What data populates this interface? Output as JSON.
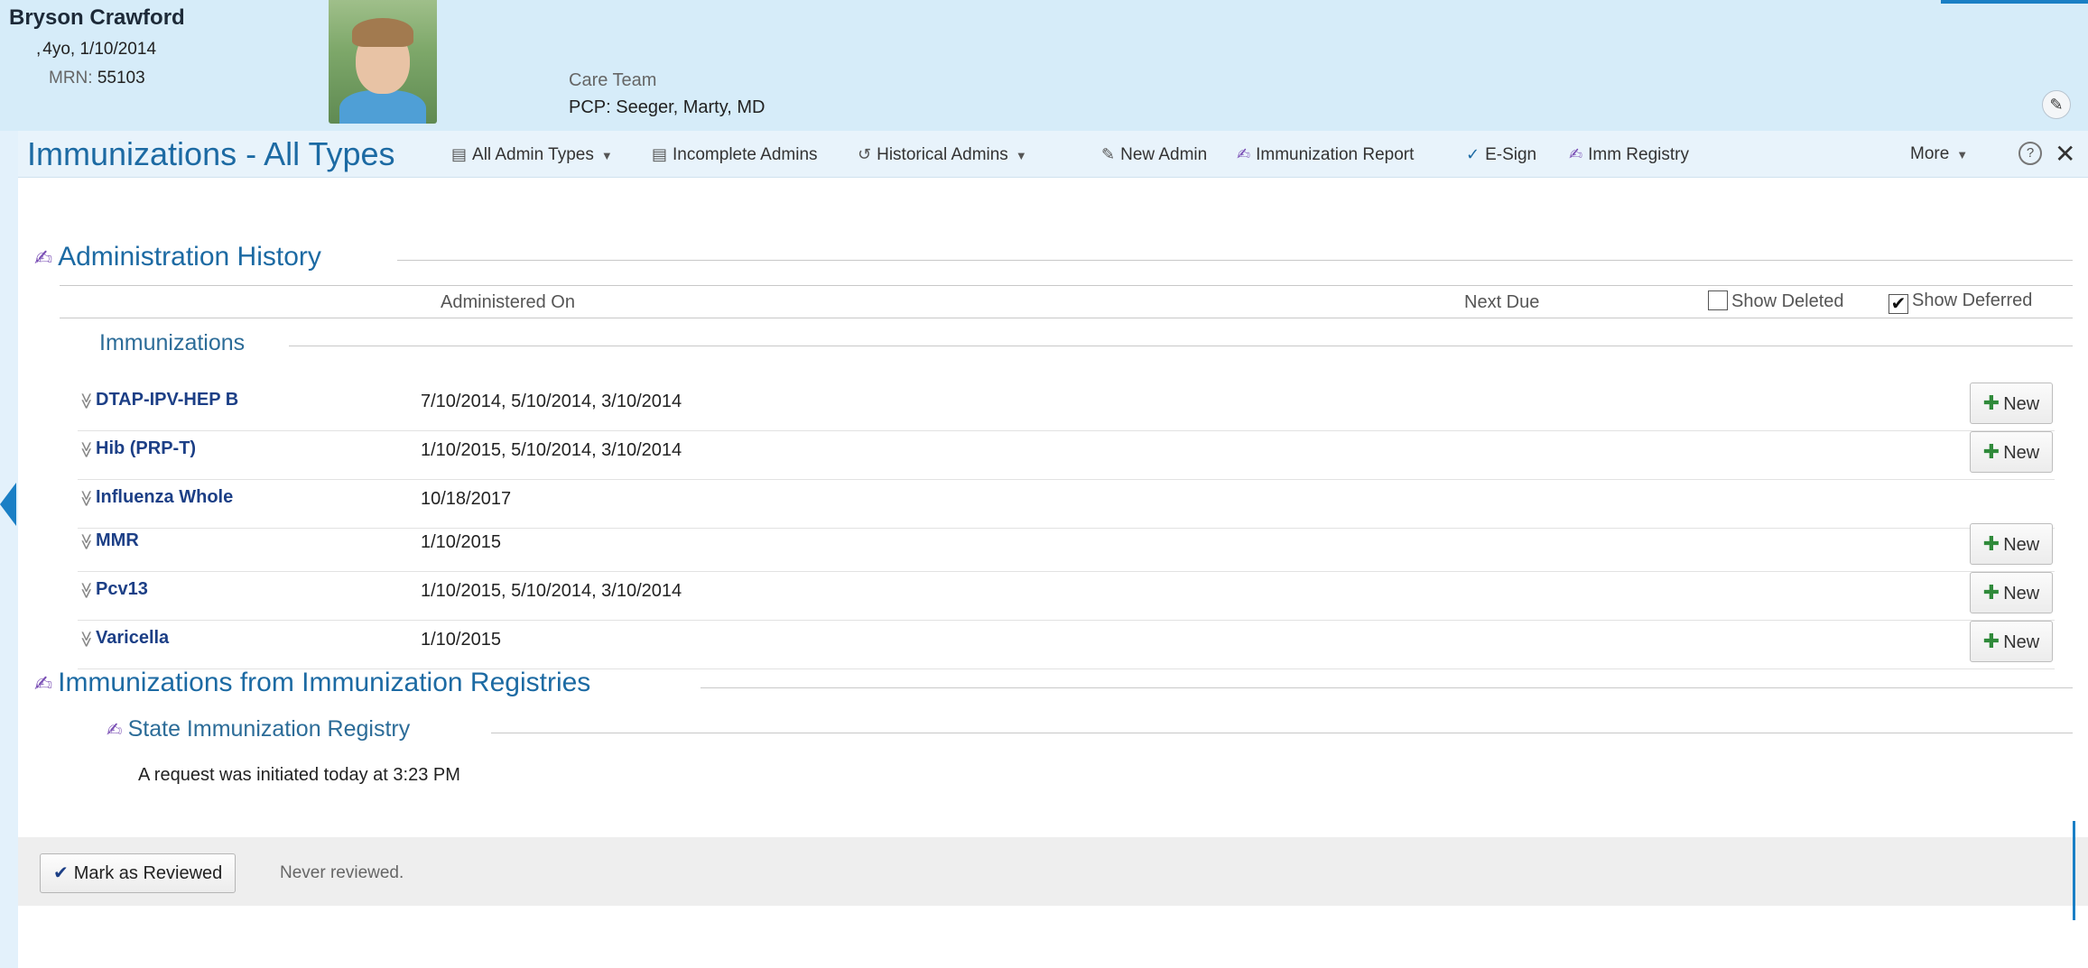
{
  "patient": {
    "name": "Bryson Crawford",
    "demographics_prefix": ",",
    "age": "4yo",
    "dob": "1/10/2014",
    "mrn_label": "MRN:",
    "mrn": "55103",
    "care_team_label": "Care Team",
    "pcp": "PCP: Seeger, Marty, MD"
  },
  "toolbar": {
    "title": "Immunizations - All Types",
    "all_admin_types": "All Admin Types",
    "incomplete_admins": "Incomplete Admins",
    "historical_admins": "Historical Admins",
    "new_admin": "New Admin",
    "immunization_report": "Immunization Report",
    "esign": "E-Sign",
    "imm_registry": "Imm Registry",
    "more": "More",
    "help": "?",
    "close": "✕"
  },
  "admin_history": {
    "title": "Administration History",
    "col_administered_on": "Administered On",
    "col_next_due": "Next Due",
    "show_deleted_label": "Show Deleted",
    "show_deleted_checked": false,
    "show_deferred_label": "Show Deferred",
    "show_deferred_checked": true,
    "group_title": "Immunizations",
    "new_label": "New",
    "rows": [
      {
        "name": "DTAP-IPV-HEP B",
        "dates": "7/10/2014, 5/10/2014, 3/10/2014",
        "has_new": true
      },
      {
        "name": "Hib (PRP-T)",
        "dates": "1/10/2015, 5/10/2014, 3/10/2014",
        "has_new": true
      },
      {
        "name": "Influenza Whole",
        "dates": "10/18/2017",
        "has_new": false
      },
      {
        "name": "MMR",
        "dates": "1/10/2015",
        "has_new": true
      },
      {
        "name": "Pcv13",
        "dates": "1/10/2015, 5/10/2014, 3/10/2014",
        "has_new": true
      },
      {
        "name": "Varicella",
        "dates": "1/10/2015",
        "has_new": true
      }
    ]
  },
  "registries": {
    "title": "Immunizations from Immunization Registries",
    "state_registry_title": "State Immunization Registry",
    "request_text": "A request was initiated today at 3:23 PM"
  },
  "review": {
    "button_label": "Mark as Reviewed",
    "status": "Never reviewed."
  }
}
